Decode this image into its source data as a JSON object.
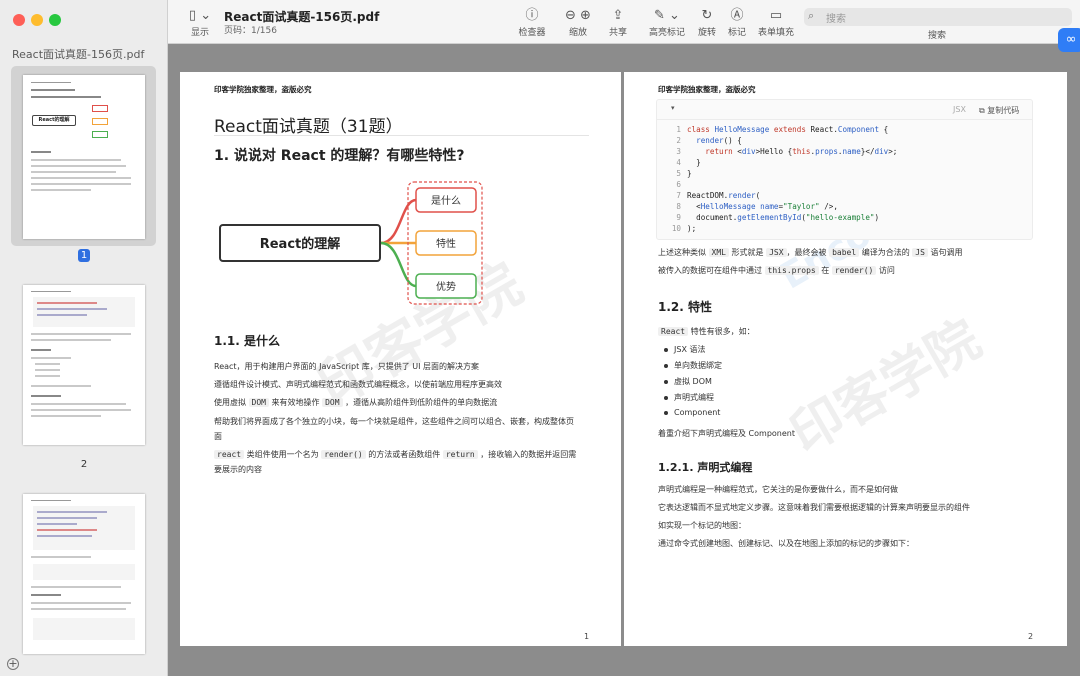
{
  "sidebar": {
    "title": "React面试真题-156页.pdf",
    "thumbnails": [
      {
        "label": "1"
      },
      {
        "label": "2"
      }
    ]
  },
  "toolbar": {
    "view_label": "显示",
    "doc_title": "React面试真题-156页.pdf",
    "page_info": "页码：1/156",
    "buttons": [
      {
        "label": "检查器",
        "icon": "info-icon"
      },
      {
        "label": "缩放",
        "icon": "zoom-icon"
      },
      {
        "label": "共享",
        "icon": "share-icon"
      },
      {
        "label": "高亮标记",
        "icon": "highlight-icon"
      },
      {
        "label": "旋转",
        "icon": "rotate-icon"
      },
      {
        "label": "标记",
        "icon": "markup-icon"
      },
      {
        "label": "表单填充",
        "icon": "form-icon"
      }
    ],
    "search_placeholder": "搜索",
    "search_label": "搜索"
  },
  "page1": {
    "header": "印客学院独家整理，盗版必究",
    "title": "React面试真题（31题）",
    "q1": "1. 说说对 React 的理解？有哪些特性?",
    "mindmap": {
      "center": "React的理解",
      "branches": [
        "是什么",
        "特性",
        "优势"
      ]
    },
    "s11": "1.1. 是什么",
    "para1": "React，用于构建用户界面的 JavaScript 库，只提供了 UI 层面的解决方案",
    "para2": "遵循组件设计模式、声明式编程范式和函数式编程概念，以使前端应用程序更高效",
    "para3": {
      "a": "使用虚拟",
      "c1": "DOM",
      "b": "来有效地操作",
      "c2": "DOM",
      "c": "，遵循从高阶组件到低阶组件的单向数据流"
    },
    "para4a": "帮助我们将界面成了各个独立的小块，每一个块就是组件，这些组件之间可以组合、嵌套，构成整体页",
    "para4b": "面",
    "para5": {
      "c1": "react",
      "a": "类组件使用一个名为",
      "c2": "render()",
      "b": "的方法或者函数组件",
      "c3": "return",
      "c": "，接收输入的数据并返回需"
    },
    "para5b": "要展示的内容",
    "page_num": "1",
    "watermark": "印客学院"
  },
  "page2": {
    "header": "印客学院独家整理，盗版必究",
    "code_lang": "JSX",
    "copy_label": "复制代码",
    "code_lines": [
      {
        "n": "1",
        "t": "class HelloMessage extends React.Component {"
      },
      {
        "n": "2",
        "t": "  render() {"
      },
      {
        "n": "3",
        "t": "    return <div>Hello {this.props.name}</div>;"
      },
      {
        "n": "4",
        "t": "  }"
      },
      {
        "n": "5",
        "t": "}"
      },
      {
        "n": "6",
        "t": ""
      },
      {
        "n": "7",
        "t": "ReactDOM.render("
      },
      {
        "n": "8",
        "t": "  <HelloMessage name=\"Taylor\" />,"
      },
      {
        "n": "9",
        "t": "  document.getElementById(\"hello-example\")"
      },
      {
        "n": "10",
        "t": ");"
      }
    ],
    "para1": {
      "a": "上述这种类似",
      "c1": "XML",
      "b": "形式就是",
      "c2": "JSX",
      "c": "，最终会被",
      "c3": "babel",
      "d": "编译为合法的",
      "c4": "JS",
      "e": "语句调用"
    },
    "para2": {
      "a": "被传入的数据可在组件中通过",
      "c1": "this.props",
      "b": "在",
      "c2": "render()",
      "c": "访问"
    },
    "s12": "1.2. 特性",
    "intro": {
      "c1": "React",
      "a": "特性有很多，如："
    },
    "features": [
      "JSX 语法",
      "单向数据绑定",
      "虚拟 DOM",
      "声明式编程",
      "Component"
    ],
    "focus": "着重介绍下声明式编程及 Component",
    "s121": "1.2.1. 声明式编程",
    "dp1": "声明式编程是一种编程范式，它关注的是你要做什么，而不是如何做",
    "dp2": "它表达逻辑而不显式地定义步骤。这意味着我们需要根据逻辑的计算来声明要显示的组件",
    "dp3": "如实现一个标记的地图：",
    "dp4": "通过命令式创建地图、创建标记、以及在地图上添加的标记的步骤如下：",
    "page_num": "2",
    "watermark": "印客学院",
    "watermark_en": "EncodeStudio"
  },
  "colors": {
    "mind_red": "#e0504a",
    "mind_orange": "#f2a33a",
    "mind_green": "#4caf50",
    "thumb_badge": "#2f6fe0"
  }
}
